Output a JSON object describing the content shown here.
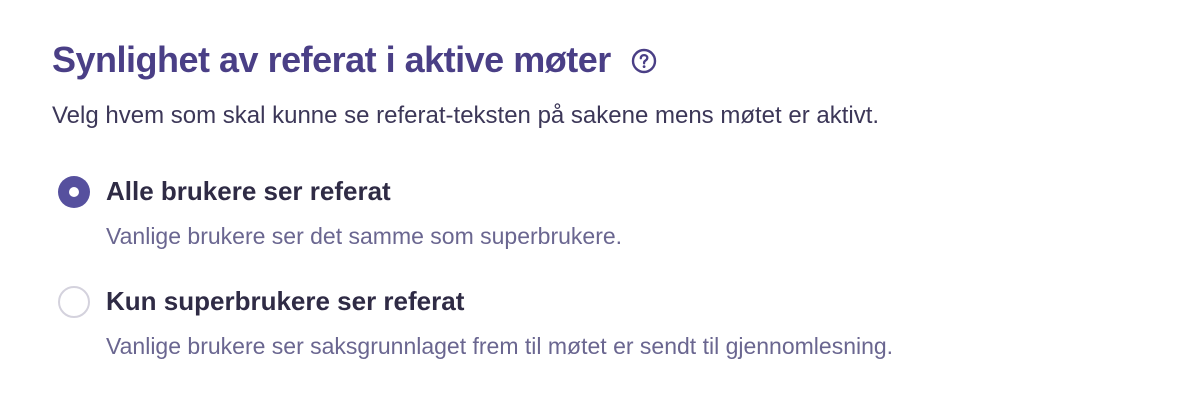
{
  "header": {
    "title": "Synlighet av referat i aktive møter",
    "help_icon": "question-circle-icon",
    "description": "Velg hvem som skal kunne se referat-teksten på sakene mens møtet er aktivt."
  },
  "options": [
    {
      "label": "Alle brukere ser referat",
      "description": "Vanlige brukere ser det samme som superbrukere.",
      "selected": true
    },
    {
      "label": "Kun superbrukere ser referat",
      "description": "Vanlige brukere ser saksgrunnlaget frem til møtet er sendt til gjennomlesning.",
      "selected": false
    }
  ],
  "colors": {
    "title": "#4a3f86",
    "accent": "#56509e",
    "text": "#2f2b45",
    "muted": "#6a6690",
    "radio_border": "#d4d2dd"
  }
}
